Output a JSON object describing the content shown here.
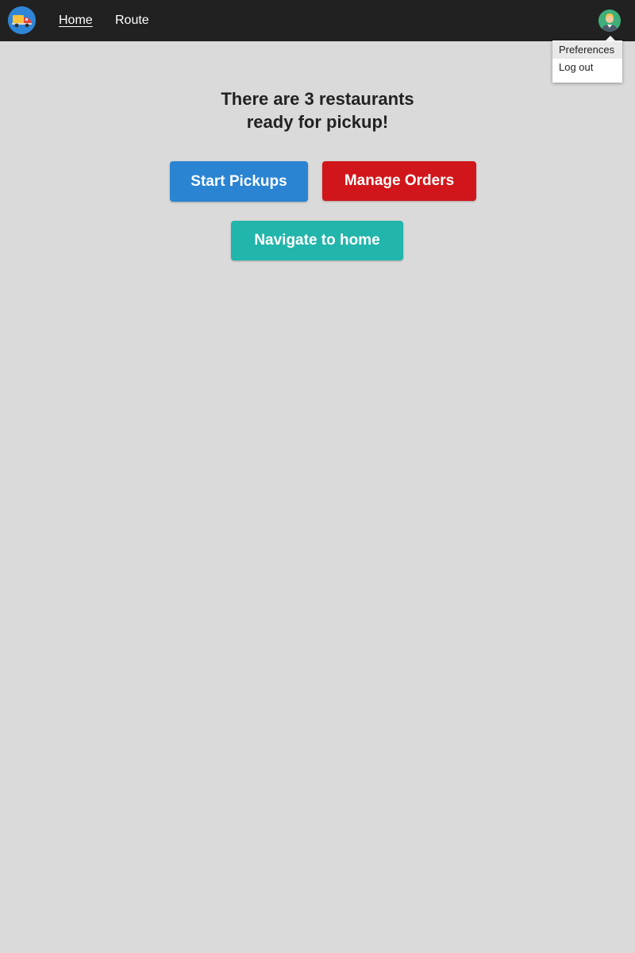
{
  "nav": {
    "logo_icon": "delivery-truck-icon",
    "links": [
      {
        "label": "Home",
        "active": true
      },
      {
        "label": "Route",
        "active": false
      }
    ],
    "avatar_icon": "user-avatar-icon"
  },
  "user_menu": {
    "items": [
      {
        "label": "Preferences",
        "highlighted": true
      },
      {
        "label": "Log out",
        "highlighted": false
      }
    ]
  },
  "main": {
    "headline_line1": "There are 3 restaurants",
    "headline_line2": "ready for pickup!",
    "buttons": {
      "start_pickups": "Start Pickups",
      "manage_orders": "Manage Orders",
      "navigate_home": "Navigate to home"
    }
  },
  "colors": {
    "navbar": "#212121",
    "background": "#dadada",
    "start_pickups": "#2a84d2",
    "manage_orders": "#d0161a",
    "navigate_home": "#22b5ab"
  }
}
